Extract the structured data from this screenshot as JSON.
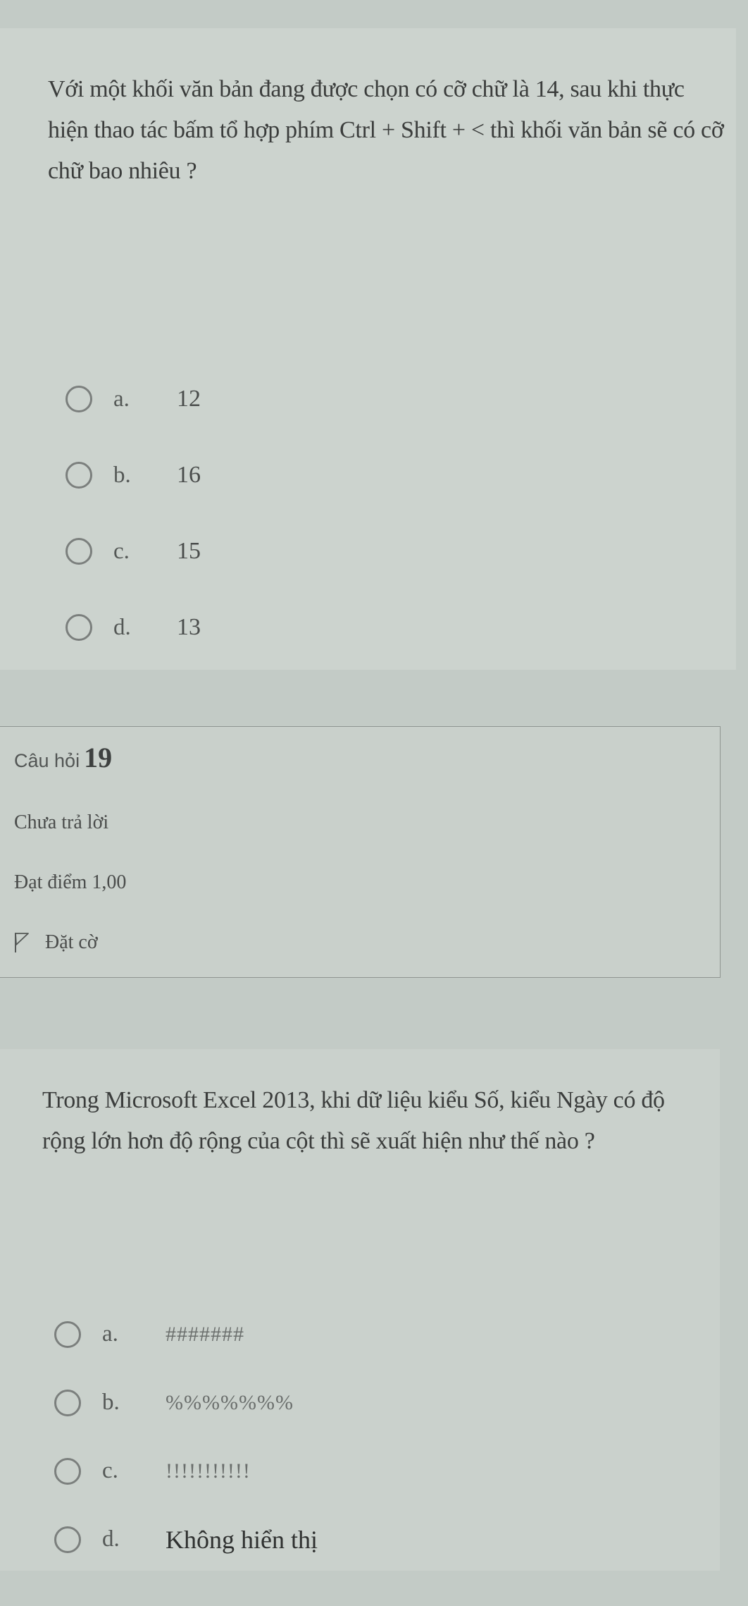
{
  "question18": {
    "text": "Với một khối văn bản đang được chọn có cỡ chữ là 14, sau khi thực hiện thao tác bấm tổ hợp phím Ctrl + Shift + < thì khối văn bản sẽ có cỡ chữ bao nhiêu ?",
    "answers": [
      {
        "letter": "a.",
        "text": "12",
        "selected": false
      },
      {
        "letter": "b.",
        "text": "16",
        "selected": false
      },
      {
        "letter": "c.",
        "text": "15",
        "selected": false
      },
      {
        "letter": "d.",
        "text": "13",
        "selected": false
      }
    ]
  },
  "question19": {
    "info": {
      "label": "Câu hỏi",
      "number": "19",
      "status": "Chưa trả lời",
      "grade": "Đạt điểm 1,00",
      "flag_label": "Đặt cờ",
      "flag_icon": "flag-outline-icon"
    },
    "text": "Trong Microsoft Excel 2013, khi dữ liệu kiểu Số, kiểu Ngày có độ rộng lớn hơn độ rộng của cột thì sẽ xuất hiện như thế nào ?",
    "answers": [
      {
        "letter": "a.",
        "text": "#######",
        "selected": false
      },
      {
        "letter": "b.",
        "text": "%%%%%%%",
        "selected": false
      },
      {
        "letter": "c.",
        "text": "!!!!!!!!!!!",
        "selected": false
      },
      {
        "letter": "d.",
        "text": "Không hiển thị",
        "selected": false
      }
    ]
  }
}
